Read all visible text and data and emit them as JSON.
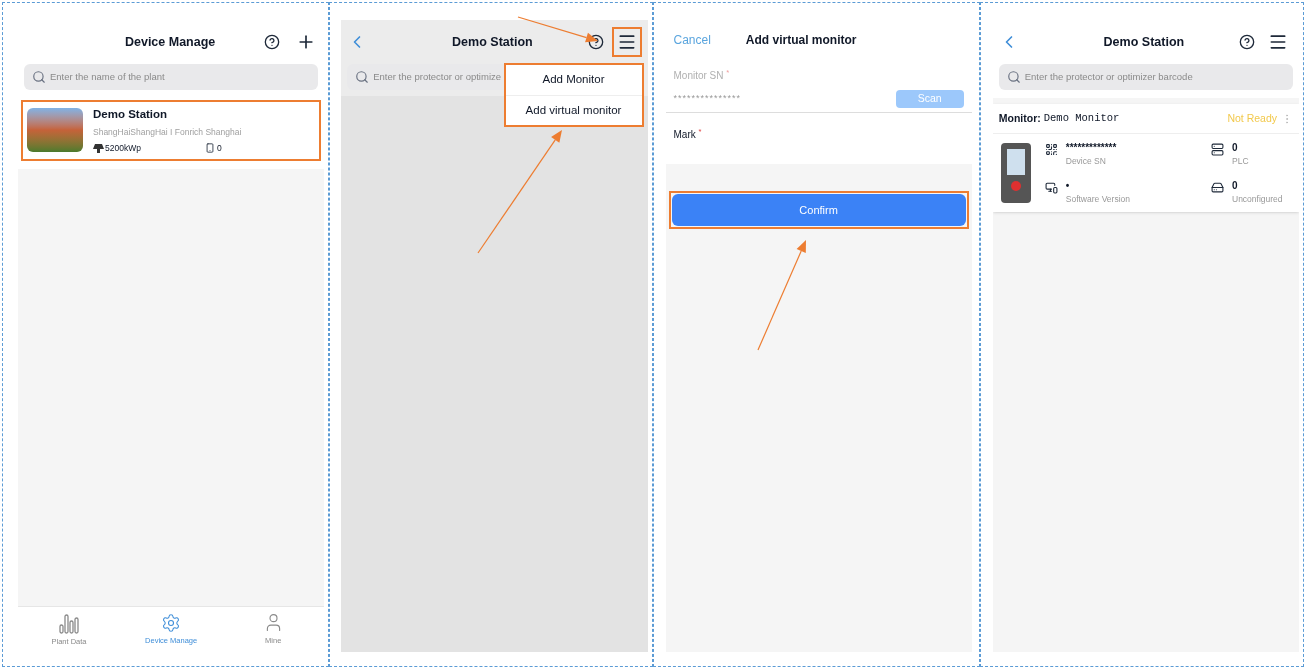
{
  "screens": [
    {
      "kind": "plant_list",
      "title": "Device Manage",
      "search": {
        "placeholder": "Enter the name of the plant"
      },
      "plants": [
        {
          "name": "Demo Station",
          "address": "ShangHaiShangHai I Fonrich Shanghai",
          "capacity": "5200kWp",
          "devices": "0",
          "highlighted": true
        }
      ],
      "tabs": [
        {
          "label": "Plant Data",
          "selected": false
        },
        {
          "label": "Device Manage",
          "selected": true
        },
        {
          "label": "Mine",
          "selected": false
        }
      ]
    },
    {
      "kind": "station_menu",
      "title": "Demo Station",
      "search": {
        "placeholder": "Enter the protector or optimize"
      },
      "menu_highlighted": true,
      "menu": {
        "highlighted": true,
        "items": [
          "Add Monitor",
          "Add virtual monitor"
        ]
      }
    },
    {
      "kind": "add_form",
      "cancel": "Cancel",
      "title": "Add virtual monitor",
      "fields": [
        {
          "label": "Monitor SN $^{*}$",
          "value": "***************",
          "scan": "Scan"
        },
        {
          "label": "Mark $^{*}$"
        }
      ],
      "confirm": {
        "label": "Confirm",
        "highlighted": true
      }
    },
    {
      "kind": "station_detail",
      "title": "Demo Station",
      "search": {
        "placeholder": "Enter the protector or optimizer barcode"
      },
      "monitor": {
        "label": "Monitor:",
        "name": "Demo Monitor",
        "status": "Not Ready",
        "sn": "*************",
        "sn_label": "Device SN",
        "version": "•",
        "version_label": "Software Version",
        "plc": "0",
        "plc_label": "PLC",
        "unconfigured": "0",
        "unconfigured_label": "Unconfigured"
      }
    }
  ]
}
